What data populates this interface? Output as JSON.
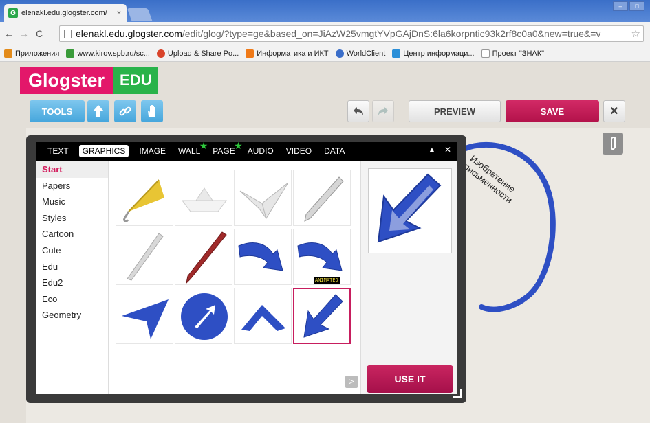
{
  "browser": {
    "tab_title": "elenakl.edu.glogster.com/",
    "tab_close": "×",
    "favicon_letter": "G",
    "url_host": "elenakl.edu.glogster.com",
    "url_rest": "/edit/glog/?type=ge&based_on=JiAzW25vmgtYVpGAjDnS:6la6korpntic93k2rf8c0a0&new=true&=v",
    "bookmarks": [
      {
        "label": "Приложения",
        "color": "#e38b1a"
      },
      {
        "label": "www.kirov.spb.ru/sc...",
        "color": "#3a9b3a"
      },
      {
        "label": "Upload & Share Po...",
        "color": "#d9432a"
      },
      {
        "label": "Информатика и ИКТ",
        "color": "#f07a18"
      },
      {
        "label": "WorldClient",
        "color": "#3b6ec9"
      },
      {
        "label": "Центр информаци...",
        "color": "#2b8fd8"
      },
      {
        "label": "Проект \"ЗНАК\"",
        "color": "#cccccc"
      }
    ]
  },
  "logo": {
    "part1": "Glogster",
    "part2": "EDU"
  },
  "toolbar": {
    "tools_label": "TOOLS",
    "preview_label": "PREVIEW",
    "save_label": "SAVE",
    "close_label": "✕"
  },
  "dialog": {
    "tabs": [
      "TEXT",
      "GRAPHICS",
      "IMAGE",
      "WALL",
      "PAGE",
      "AUDIO",
      "VIDEO",
      "DATA"
    ],
    "active_tab": "GRAPHICS",
    "categories": [
      "Start",
      "Papers",
      "Music",
      "Styles",
      "Cartoon",
      "Cute",
      "Edu",
      "Edu2",
      "Eco",
      "Geometry"
    ],
    "active_category": "Start",
    "animated_badge": "ANIMATED",
    "use_it_label": "USE IT",
    "next_label": ">"
  },
  "canvas": {
    "bubble_text_line1": "Изобретение",
    "bubble_text_line2": "письменности"
  },
  "colors": {
    "accent": "#c71e5e",
    "blue": "#46a6dc",
    "arrow_blue": "#2e4fc4"
  }
}
